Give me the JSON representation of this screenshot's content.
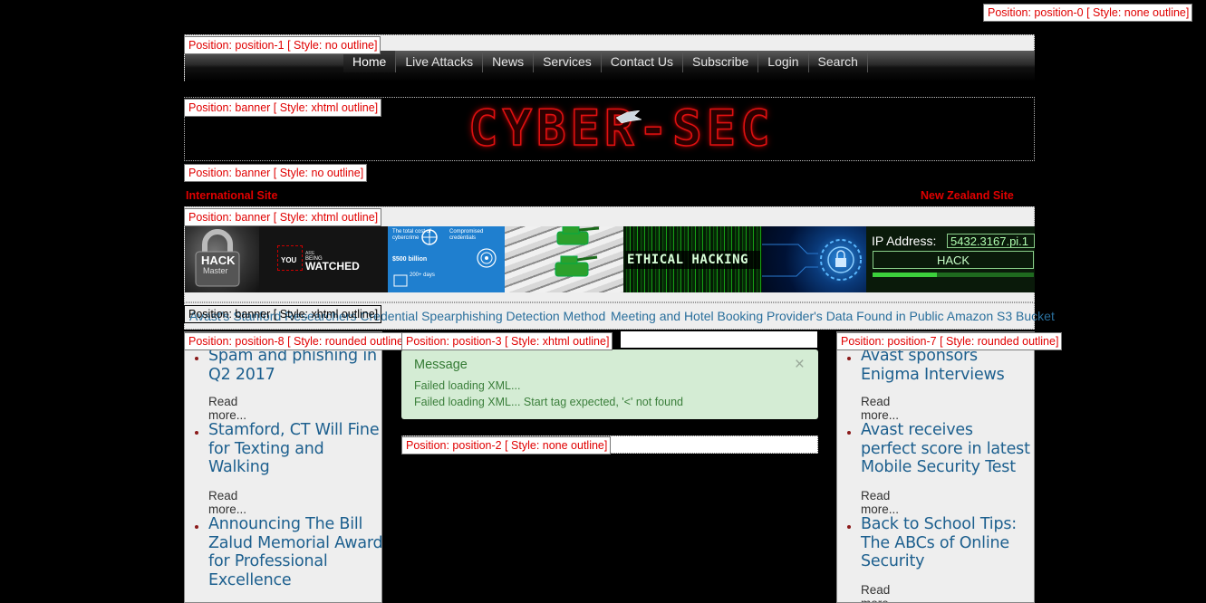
{
  "labels": {
    "position0": "Position: position-0 [ Style: none outline]",
    "position1": "Position: position-1 [ Style: no outline]",
    "banner_xhtml_1": "Position: banner [ Style: xhtml outline]",
    "banner_no": "Position: banner [ Style: no outline]",
    "banner_xhtml_2": "Position: banner [ Style: xhtml outline]",
    "banner_xhtml_3": "Position: banner [ Style: xhtml outline]",
    "position8": "Position: position-8 [ Style: rounded outline]",
    "position3": "Position: position-3 [ Style: xhtml outline]",
    "position7": "Position: position-7 [ Style: rounded outline]",
    "position2": "Position: position-2 [ Style: none outline]"
  },
  "nav": {
    "items": [
      "Home",
      "Live Attacks",
      "News",
      "Services",
      "Contact Us",
      "Subscribe",
      "Login",
      "Search"
    ],
    "active": "Home"
  },
  "logo": {
    "text": "CYBER-SEC"
  },
  "sites": {
    "international": "International Site",
    "newzealand": "New Zealand Site"
  },
  "strip": {
    "tile1_text1": "HACK",
    "tile1_text2": "Master",
    "tile2_text1": "YOU",
    "tile2_text2": "ARE",
    "tile2_text3": "BEING",
    "tile2_text4": "WATCHED",
    "tile3_text1": "The total cost of cybercrime",
    "tile3_text2": "$500 billion",
    "tile3_text3": "Compromised credentials",
    "tile3_text4": "200+ days",
    "tile5_text": "ETHICAL HACKING",
    "tile7_label": "IP Address:",
    "tile7_value": "5432.3167.pi.1",
    "tile7_button": "HACK"
  },
  "ticker": {
    "items": [
      "Avast's Stanford Researchers Credential Spearphishing Detection Method",
      "Meeting and Hotel Booking Provider's Data Found in Public Amazon S3 Bucket"
    ]
  },
  "left_news": [
    {
      "title": "Spam and phishing in Q2 2017",
      "readmore": "Read more..."
    },
    {
      "title": "Stamford, CT Will Fine for Texting and Walking",
      "readmore": "Read more..."
    },
    {
      "title": "Announcing The Bill Zalud Memorial Award for Professional Excellence",
      "readmore": ""
    }
  ],
  "right_news": [
    {
      "title": "Avast sponsors Enigma Interviews",
      "readmore": "Read more..."
    },
    {
      "title": "Avast receives perfect score in latest Mobile Security Test",
      "readmore": "Read more..."
    },
    {
      "title": "Back to School Tips: The ABCs of Online Security",
      "readmore": "Read more..."
    }
  ],
  "message": {
    "title": "Message",
    "close": "×",
    "line1": "Failed loading XML...",
    "line2": "Failed loading XML... Start tag expected, '<' not found"
  },
  "colors": {
    "accent_red": "#e00000",
    "link_blue": "#1c5f8e",
    "message_bg": "#d4ecd4",
    "message_text": "#3b7f3b"
  }
}
